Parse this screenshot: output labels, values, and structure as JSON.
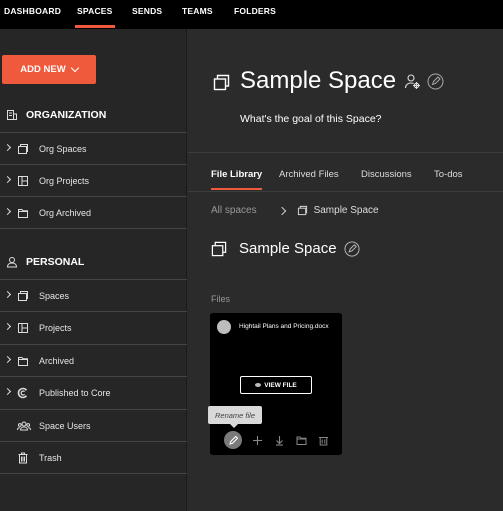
{
  "nav": {
    "items": [
      {
        "label": "DASHBOARD",
        "active": false
      },
      {
        "label": "SPACES",
        "active": true
      },
      {
        "label": "SENDS",
        "active": false
      },
      {
        "label": "TEAMS",
        "active": false
      },
      {
        "label": "FOLDERS",
        "active": false
      }
    ]
  },
  "sidebar": {
    "add_new_label": "ADD NEW",
    "organization": {
      "title": "ORGANIZATION",
      "items": [
        {
          "label": "Org Spaces",
          "icon": "space-icon"
        },
        {
          "label": "Org Projects",
          "icon": "project-icon"
        },
        {
          "label": "Org Archived",
          "icon": "archive-folder-icon"
        }
      ]
    },
    "personal": {
      "title": "PERSONAL",
      "items": [
        {
          "label": "Spaces",
          "icon": "space-icon"
        },
        {
          "label": "Projects",
          "icon": "project-icon"
        },
        {
          "label": "Archived",
          "icon": "archive-folder-icon"
        },
        {
          "label": "Published to Core",
          "icon": "core-icon"
        },
        {
          "label": "Space Users",
          "icon": "users-icon"
        },
        {
          "label": "Trash",
          "icon": "trash-icon"
        }
      ]
    }
  },
  "main": {
    "title": "Sample Space",
    "goal_placeholder": "What's the goal of this Space?",
    "tabs": [
      {
        "label": "File Library",
        "active": true
      },
      {
        "label": "Archived Files",
        "active": false
      },
      {
        "label": "Discussions",
        "active": false
      },
      {
        "label": "To-dos",
        "active": false
      }
    ],
    "breadcrumb": {
      "root": "All spaces",
      "current": "Sample Space"
    },
    "subheading": "Sample Space",
    "files_label": "Files",
    "file": {
      "name": "Hightail Plans and Pricing.docx",
      "view_label": "VIEW FILE",
      "tooltip": "Rename file"
    }
  },
  "colors": {
    "accent": "#f05a3c",
    "background": "#2b2b2b",
    "topbar": "#000000"
  }
}
